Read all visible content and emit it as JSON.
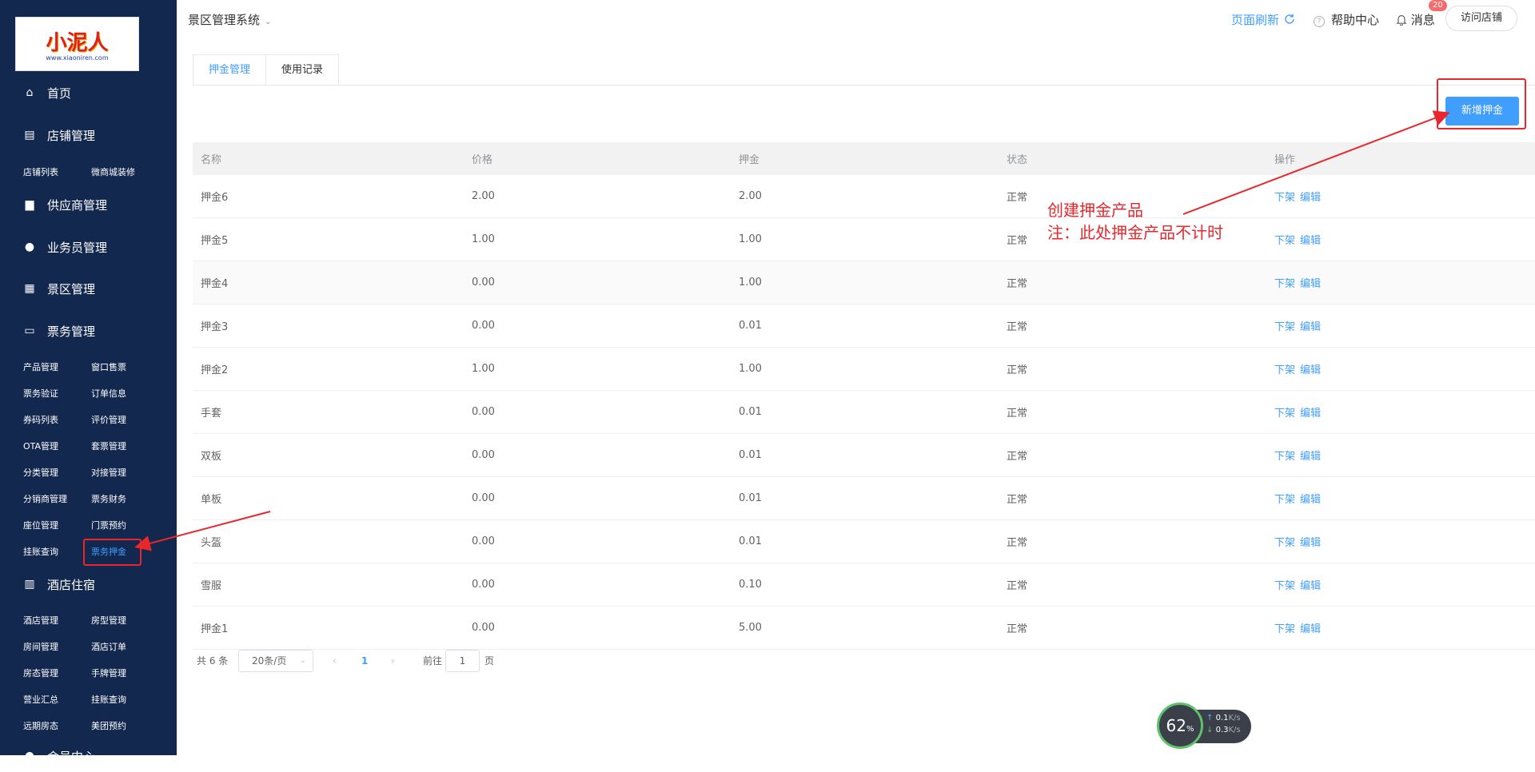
{
  "logo": {
    "text": "小泥人",
    "url_text": "www.xiaoniren.com"
  },
  "nav": [
    {
      "icon": "home-icon",
      "glyph": "⌂",
      "label": "首页"
    },
    {
      "icon": "store-icon",
      "glyph": "▤",
      "label": "店铺管理"
    },
    {
      "icon": "truck-icon",
      "glyph": "▆",
      "label": "供应商管理"
    },
    {
      "icon": "user-icon",
      "glyph": "●",
      "label": "业务员管理"
    },
    {
      "icon": "scenic-icon",
      "glyph": "▦",
      "label": "景区管理"
    },
    {
      "icon": "ticket-icon",
      "glyph": "▭",
      "label": "票务管理"
    },
    {
      "icon": "hotel-icon",
      "glyph": "▥",
      "label": "酒店住宿"
    },
    {
      "icon": "member-icon",
      "glyph": "●",
      "label": "会员中心"
    }
  ],
  "store_sub": [
    "店铺列表",
    "微商城装修"
  ],
  "ticket_sub": [
    "产品管理",
    "窗口售票",
    "票务验证",
    "订单信息",
    "券码列表",
    "评价管理",
    "OTA管理",
    "套票管理",
    "分类管理",
    "对接管理",
    "分销商管理",
    "票务财务",
    "座位管理",
    "门票预约",
    "挂账查询",
    "票务押金"
  ],
  "hotel_sub": [
    "酒店管理",
    "房型管理",
    "房间管理",
    "酒店订单",
    "房态管理",
    "手牌管理",
    "营业汇总",
    "挂账查询",
    "远期房态",
    "美团预约"
  ],
  "header": {
    "title": "景区管理系统",
    "refresh": "页面刷新",
    "help": "帮助中心",
    "message": "消息",
    "badge": "20",
    "visit": "访问店铺"
  },
  "tabs": [
    "押金管理",
    "使用记录"
  ],
  "add_button": "新增押金",
  "table": {
    "headers": [
      "名称",
      "价格",
      "押金",
      "状态",
      "操作"
    ],
    "rows": [
      [
        "押金6",
        "2.00",
        "2.00",
        "正常"
      ],
      [
        "押金5",
        "1.00",
        "1.00",
        "正常"
      ],
      [
        "押金4",
        "0.00",
        "1.00",
        "正常"
      ],
      [
        "押金3",
        "0.00",
        "0.01",
        "正常"
      ],
      [
        "押金2",
        "1.00",
        "1.00",
        "正常"
      ],
      [
        "手套",
        "0.00",
        "0.01",
        "正常"
      ],
      [
        "双板",
        "0.00",
        "0.01",
        "正常"
      ],
      [
        "单板",
        "0.00",
        "0.01",
        "正常"
      ],
      [
        "头盔",
        "0.00",
        "0.01",
        "正常"
      ],
      [
        "雪服",
        "0.00",
        "0.10",
        "正常"
      ],
      [
        "押金1",
        "0.00",
        "5.00",
        "正常"
      ]
    ],
    "action_off": "下架",
    "action_edit": "编辑"
  },
  "pager": {
    "total": "共 6 条",
    "size": "20条/页",
    "current": "1",
    "goto_label": "前往",
    "goto_value": "1",
    "page_suffix": "页"
  },
  "annotation": {
    "line1": "创建押金产品",
    "line2": "注：此处押金产品不计时"
  },
  "speed_widget": {
    "percent": "62",
    "unit": "%",
    "up": "0.1",
    "down": "0.3",
    "rate_unit": "K/s"
  },
  "colors": {
    "sidebar": "#13284f",
    "accent": "#409eff",
    "annotation": "#e8262c"
  }
}
